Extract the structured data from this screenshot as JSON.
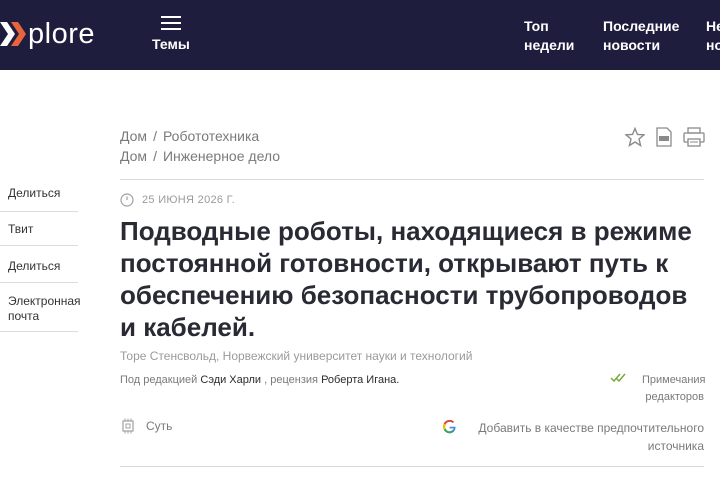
{
  "header": {
    "logo_text": "plore",
    "menu_label": "Темы",
    "nav": [
      {
        "line1": "Топ",
        "line2": "недели"
      },
      {
        "line1": "Последние",
        "line2": "новости"
      },
      {
        "line1": "Не",
        "line2": "но"
      }
    ]
  },
  "share": [
    "Делиться",
    "Твит",
    "Делиться",
    "Электронная почта"
  ],
  "breadcrumbs": [
    {
      "home": "Дом",
      "section": "Робототехника"
    },
    {
      "home": "Дом",
      "section": "Инженерное дело"
    }
  ],
  "breadcrumb_separator": "/",
  "tools": [
    "star-icon",
    "pdf-icon",
    "print-icon"
  ],
  "article": {
    "date": "25 ИЮНЯ 2026 Г.",
    "title": "Подводные роботы, находящиеся в режиме постоянной готовности, открывают путь к обеспечению безопасности трубопроводов и кабелей.",
    "author": "Торе Стенсвольд, Норвежский университет науки и технологий",
    "edited_prefix": "Под редакцией",
    "editor": "Сэди Харли",
    "reviewed_prefix": ", рецензия",
    "reviewer": "Роберта Игана.",
    "notes": "Примечания редакторов",
    "gist": "Суть",
    "google_pref": "Добавить в качестве предпочтительного источника"
  },
  "colors": {
    "header_bg": "#1f1d3d",
    "logo_accent": "#e8643c",
    "check_green": "#7aa83a"
  }
}
